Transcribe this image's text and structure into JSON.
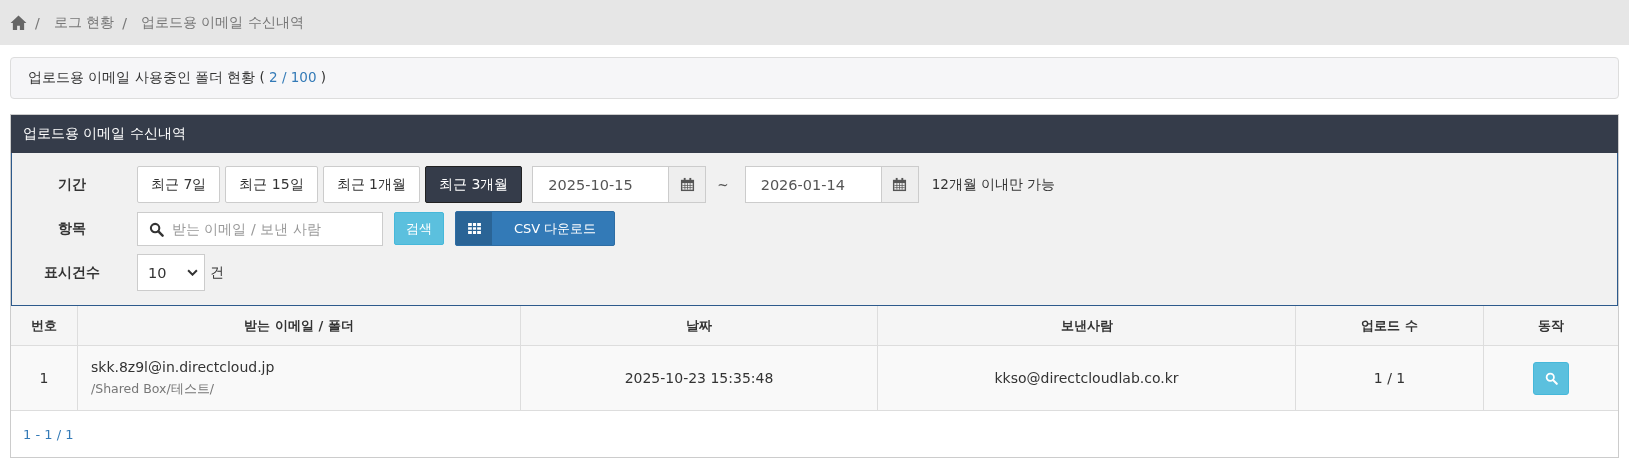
{
  "breadcrumb": [
    "/",
    "로그 현황",
    "/",
    "업로드용 이메일 수신내역"
  ],
  "summary": {
    "label": "업로드용 이메일 사용중인 폴더 현황 (",
    "used": "2 / 100",
    "close": ")"
  },
  "panel": {
    "title": "업로드용 이메일 수신내역"
  },
  "filters": {
    "period_label": "기간",
    "periods": [
      {
        "label": "최근 7일",
        "selected": false
      },
      {
        "label": "최근 15일",
        "selected": false
      },
      {
        "label": "최근 1개월",
        "selected": false
      },
      {
        "label": "최근 3개월",
        "selected": true
      }
    ],
    "date_from": "2025-10-15",
    "tilde": "~",
    "date_to": "2026-01-14",
    "note": "12개월 이내만 가능",
    "item_label": "항목",
    "search_placeholder": "받는 이메일 / 보낸 사람",
    "search_button": "검색",
    "csv_button": "CSV 다운로드",
    "count_label": "표시건수",
    "count_value": "10",
    "count_unit": "건"
  },
  "table": {
    "columns": [
      "번호",
      "받는 이메일 / 폴더",
      "날짜",
      "보낸사람",
      "업로드 수",
      "동작"
    ],
    "rows": [
      {
        "no": "1",
        "email": "skk.8z9l@in.directcloud.jp",
        "folder": "/Shared Box/테스트/",
        "date": "2025-10-23 15:35:48",
        "sender": "kkso@directcloudlab.co.kr",
        "uploads": "1 / 1"
      }
    ]
  },
  "pagination": "1 - 1 / 1"
}
